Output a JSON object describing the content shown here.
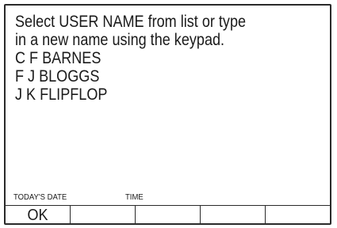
{
  "prompt": {
    "line1": "Select USER NAME from list or type",
    "line2": "in a new name using the keypad."
  },
  "user_list": [
    "C F BARNES",
    "F J BLOGGS",
    "J K FLIPFLOP"
  ],
  "status": {
    "date_label": "TODAY'S DATE",
    "time_label": "TIME"
  },
  "softkeys": [
    {
      "label": "OK"
    },
    {
      "label": ""
    },
    {
      "label": ""
    },
    {
      "label": ""
    },
    {
      "label": ""
    }
  ]
}
